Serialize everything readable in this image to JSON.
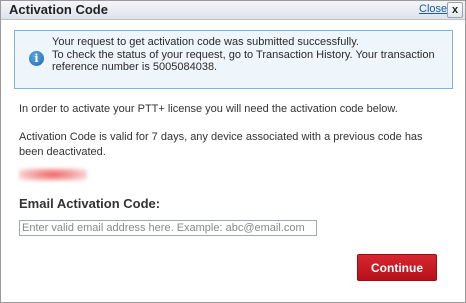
{
  "dialog": {
    "title": "Activation Code",
    "close_link": "Close",
    "close_glyph": "x"
  },
  "notice": {
    "icon": "info-icon",
    "icon_glyph": "i",
    "lines": [
      "Your request to get activation code was submitted successfully.",
      "To check the status of your request, go to Transaction History. Your transaction reference number is 5005084038."
    ]
  },
  "body": {
    "instruction": "In order to activate your PTT+ license you will need the activation code below.",
    "validity": "Activation Code is valid for 7 days, any device associated with a previous code has been deactivated."
  },
  "email": {
    "label": "Email Activation Code:",
    "placeholder": "Enter valid email address here. Example: abc@email.com",
    "value": ""
  },
  "actions": {
    "continue_label": "Continue"
  },
  "colors": {
    "accent_red": "#c81a24",
    "notice_bg": "#eef5fb",
    "notice_border": "#7fb3dc",
    "link_blue": "#1a5ea8"
  }
}
